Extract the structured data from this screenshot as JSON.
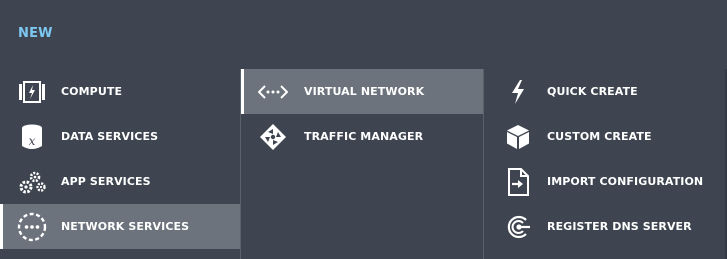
{
  "header": {
    "title": "NEW"
  },
  "categories": [
    {
      "label": "COMPUTE",
      "icon": "compute-icon"
    },
    {
      "label": "DATA SERVICES",
      "icon": "data-services-icon"
    },
    {
      "label": "APP SERVICES",
      "icon": "app-services-icon"
    },
    {
      "label": "NETWORK SERVICES",
      "icon": "network-services-icon",
      "selected": true
    }
  ],
  "network_services": [
    {
      "label": "VIRTUAL NETWORK",
      "icon": "virtual-network-icon",
      "selected": true
    },
    {
      "label": "TRAFFIC MANAGER",
      "icon": "traffic-manager-icon"
    }
  ],
  "actions": [
    {
      "label": "QUICK CREATE",
      "icon": "lightning-icon"
    },
    {
      "label": "CUSTOM CREATE",
      "icon": "cube-icon"
    },
    {
      "label": "IMPORT CONFIGURATION",
      "icon": "import-file-icon"
    },
    {
      "label": "REGISTER DNS SERVER",
      "icon": "dns-icon"
    }
  ],
  "colors": {
    "background": "#3e4550",
    "accent": "#7cc8f0",
    "selected": "#6c737c"
  }
}
